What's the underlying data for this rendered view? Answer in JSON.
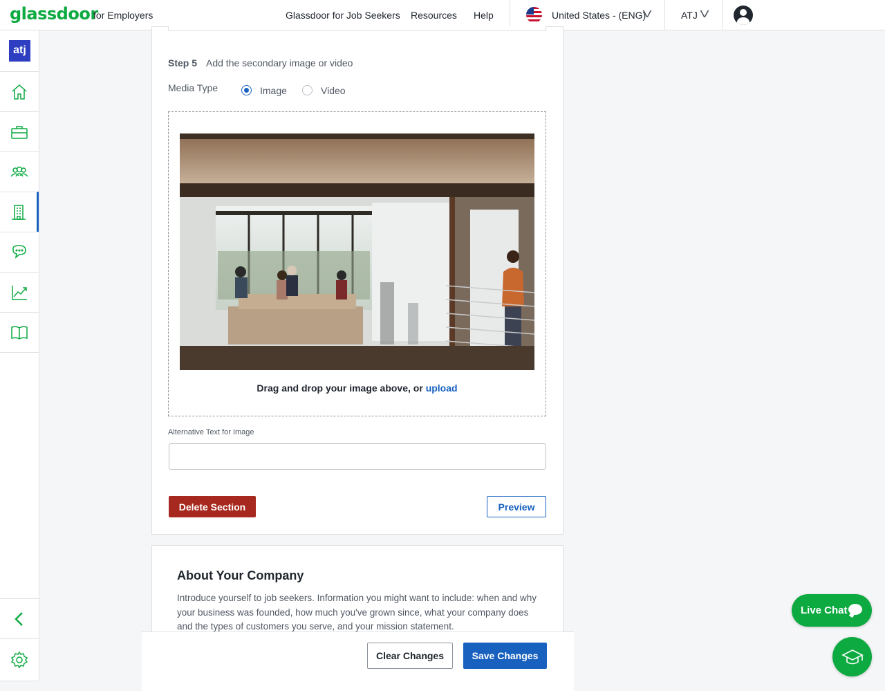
{
  "header": {
    "logo": "glassdoor",
    "logo_sub": "for Employers",
    "nav": [
      "Glassdoor for Job Seekers",
      "Resources",
      "Help"
    ],
    "locale": "United States - (ENG)",
    "account": "ATJ"
  },
  "sidebar": {
    "company_logo": "atj",
    "items": [
      {
        "icon": "home-icon"
      },
      {
        "icon": "briefcase-icon"
      },
      {
        "icon": "people-icon"
      },
      {
        "icon": "building-icon",
        "active": true
      },
      {
        "icon": "chat-bubbles-icon"
      },
      {
        "icon": "chart-icon"
      },
      {
        "icon": "book-icon"
      }
    ]
  },
  "step": {
    "number": "Step 5",
    "title": "Add the secondary image or video",
    "media_type_label": "Media Type",
    "options": [
      "Image",
      "Video"
    ],
    "selected": "Image"
  },
  "dropzone": {
    "text": "Drag and drop your image above, or",
    "link": "upload"
  },
  "alt_text": {
    "label": "Alternative Text for Image",
    "value": ""
  },
  "buttons": {
    "delete": "Delete Section",
    "preview": "Preview",
    "clear": "Clear Changes",
    "save": "Save Changes"
  },
  "about": {
    "title": "About Your Company",
    "description": "Introduce yourself to job seekers. Information you might want to include: when and why your business was founded, how much you've grown since, what your company does and the types of customers you serve, and your mission statement."
  },
  "live_chat": "Live Chat",
  "colors": {
    "brand_green": "#0caa41",
    "primary_blue": "#1861bf",
    "delete_red": "#a7281e"
  }
}
